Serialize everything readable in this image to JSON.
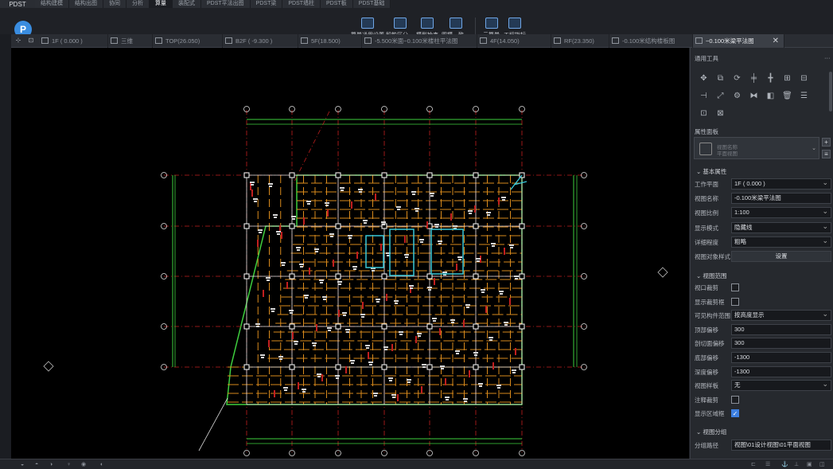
{
  "app": {
    "logo_text": "PDST",
    "badge": "P"
  },
  "menu_tabs": [
    {
      "label": "结构建模",
      "active": false
    },
    {
      "label": "结构出图",
      "active": false
    },
    {
      "label": "协同",
      "active": false
    },
    {
      "label": "分析",
      "active": false
    },
    {
      "label": "算量",
      "active": true
    },
    {
      "label": "装配式",
      "active": false
    },
    {
      "label": "PDST平法出图",
      "active": false
    },
    {
      "label": "PDST梁",
      "active": false
    },
    {
      "label": "PDST墙柱",
      "active": false
    },
    {
      "label": "PDST板",
      "active": false
    },
    {
      "label": "PDST基础",
      "active": false
    }
  ],
  "ribbon": {
    "buttons": [
      {
        "label": "算量通用设置",
        "icon": "gfc-settings-icon"
      },
      {
        "label": "智能区分···",
        "icon": "smart-distinguish-icon"
      },
      {
        "label": "模型检查",
        "icon": "model-check-icon"
      },
      {
        "label": "图模一致···",
        "icon": "drawing-model-consistency-icon"
      },
      {
        "label": "云算量",
        "icon": "cloud-quantity-icon"
      },
      {
        "label": "工程指标",
        "icon": "project-index-icon"
      }
    ]
  },
  "view_tabs": [
    {
      "label": "1F ( 0.000 )",
      "active": false
    },
    {
      "label": "三维",
      "active": false
    },
    {
      "label": "TOP(26.050)",
      "active": false
    },
    {
      "label": "B2F ( -9.300 )",
      "active": false
    },
    {
      "label": "5F(18.500)",
      "active": false
    },
    {
      "label": "-5.500米面~0.100米楼柱平法图",
      "active": false
    },
    {
      "label": "4F(14.050)",
      "active": false
    },
    {
      "label": "RF(23.350)",
      "active": false
    },
    {
      "label": "-0.100米结构楼板图",
      "active": false
    },
    {
      "label": "~0.100米梁平法图",
      "active": true
    }
  ],
  "panel": {
    "tools_title": "通用工具",
    "props_title": "属性面板",
    "selector_line1": "视图名称",
    "selector_line2": "平面视图",
    "basic_section": "基本属性",
    "basic_props": [
      {
        "label": "工作平面",
        "value": "1F ( 0.000 )",
        "type": "select"
      },
      {
        "label": "视图名称",
        "value": "-0.100米梁平法图",
        "type": "text"
      },
      {
        "label": "视图比例",
        "value": "1:100",
        "type": "select"
      },
      {
        "label": "显示模式",
        "value": "隐藏线",
        "type": "select"
      },
      {
        "label": "详细程度",
        "value": "粗略",
        "type": "select"
      },
      {
        "label": "视图对象样式",
        "value": "设置",
        "type": "button"
      }
    ],
    "range_section": "视图范围",
    "range_props": [
      {
        "label": "视口裁剪",
        "type": "checkbox",
        "checked": false
      },
      {
        "label": "显示裁剪框",
        "type": "checkbox",
        "checked": false
      },
      {
        "label": "可见构件范围",
        "value": "按高度显示",
        "type": "select"
      },
      {
        "label": "顶部偏移",
        "value": "300",
        "type": "text"
      },
      {
        "label": "剖切面偏移",
        "value": "300",
        "type": "text"
      },
      {
        "label": "底部偏移",
        "value": "-1300",
        "type": "text"
      },
      {
        "label": "深度偏移",
        "value": "-1300",
        "type": "text"
      },
      {
        "label": "视图样板",
        "value": "无",
        "type": "select"
      },
      {
        "label": "注释裁剪",
        "type": "checkbox",
        "checked": false
      },
      {
        "label": "显示区域框",
        "type": "checkbox",
        "checked": true
      }
    ],
    "group_section": "视图分组",
    "group_props": [
      {
        "label": "分组路径",
        "value": "视图\\01设计视图\\01平面视图",
        "type": "text"
      }
    ]
  },
  "colors": {
    "background": "#1b1d22",
    "canvas": "#000000",
    "beam": "#d98a1c",
    "grid_axis": "#c21f1f",
    "outline": "#3ecf3e",
    "selection": "#38c8d8",
    "accent": "#3d7fe0"
  }
}
